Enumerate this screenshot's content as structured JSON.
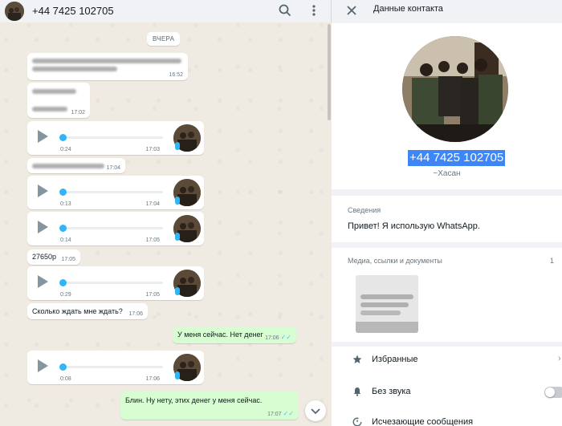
{
  "chat": {
    "header": {
      "title": "+44 7425 102705"
    },
    "date_chip": "ВЧЕРА",
    "messages": [
      {
        "kind": "text",
        "text": "",
        "time": "16:52"
      },
      {
        "kind": "text",
        "text": "",
        "time": "17:02"
      },
      {
        "kind": "voice",
        "duration": "0:24",
        "time": "17:03"
      },
      {
        "kind": "text",
        "text": "",
        "time": "17:04"
      },
      {
        "kind": "voice",
        "duration": "0:13",
        "time": "17:04"
      },
      {
        "kind": "voice",
        "duration": "0:14",
        "time": "17:05"
      },
      {
        "kind": "text",
        "text": "27650р",
        "time": "17:05"
      },
      {
        "kind": "voice",
        "duration": "0:29",
        "time": "17:05"
      },
      {
        "kind": "text",
        "text": "Сколько ждать мне ждать?",
        "time": "17:06"
      },
      {
        "kind": "text_out",
        "text": "У меня сейчас. Нет денег",
        "time": "17:06"
      },
      {
        "kind": "voice",
        "duration": "0:08",
        "time": "17:06"
      },
      {
        "kind": "text_out",
        "text": "Блин. Ну нету, этих денег у меня сейчас.",
        "time": "17:07"
      }
    ],
    "check_mark": "✓✓"
  },
  "contact_info": {
    "header_title": "Данные контакта",
    "number": "+44 7425 102705",
    "name": "~Хасан",
    "about_label": "Сведения",
    "about_text": "Привет! Я использую WhatsApp.",
    "media_label": "Медиа, ссылки и документы",
    "media_count": "1",
    "actions": {
      "starred": "Избранные",
      "mute": "Без звука",
      "disappearing": "Исчезающие сообщения"
    },
    "chevron": "›"
  },
  "icons": [
    "search-icon",
    "menu-icon",
    "close-icon",
    "star-icon",
    "bell-icon",
    "timer-icon",
    "chevron-down-icon",
    "play-icon",
    "mic-icon"
  ],
  "colors": {
    "accent": "#30b6f6",
    "outgoing": "#d9fdd3",
    "selection": "#3e86f5"
  }
}
